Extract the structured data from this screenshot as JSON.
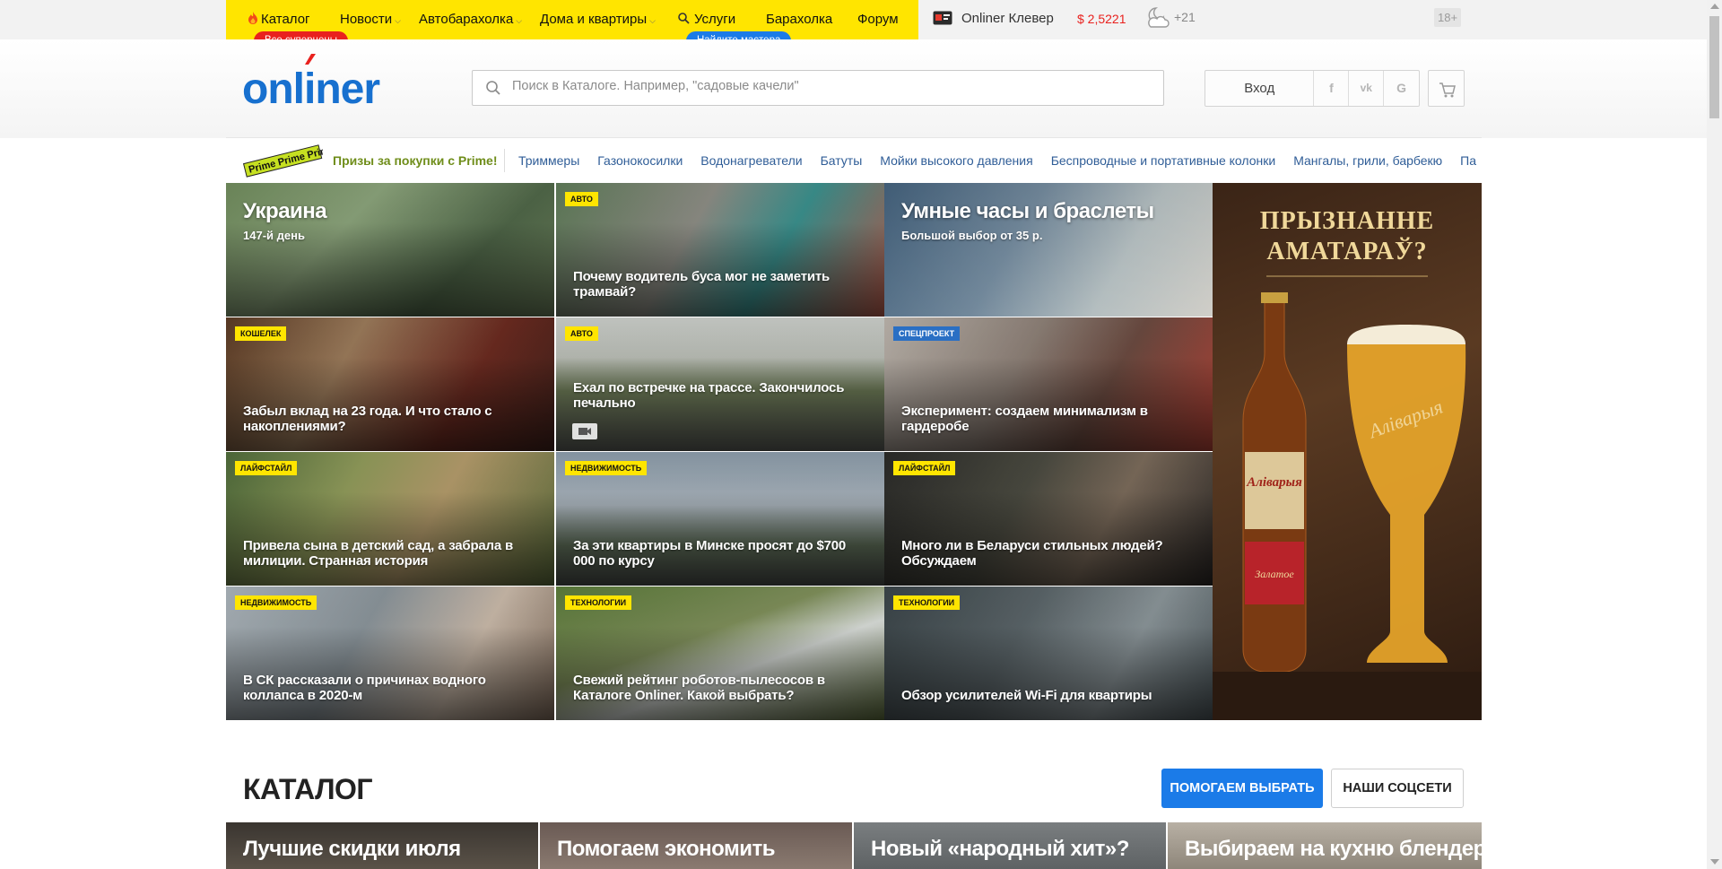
{
  "topnav": {
    "items": [
      {
        "label": "Каталог"
      },
      {
        "label": "Новости"
      },
      {
        "label": "Автобарахолка"
      },
      {
        "label": "Дома и квартиры"
      },
      {
        "label": "Услуги"
      },
      {
        "label": "Барахолка"
      },
      {
        "label": "Форум"
      }
    ],
    "pill_catalog": "Все суперцены",
    "pill_services": "Найдите мастера",
    "clever": "Onliner Клевер",
    "currency": "$ 2,5221",
    "weather": "+21",
    "age": "18+"
  },
  "header": {
    "logo": "onliner",
    "search_placeholder": "Поиск в Каталоге. Например, \"садовые качели\"",
    "login": "Вход",
    "social": [
      "f",
      "vk",
      "G"
    ]
  },
  "strip": {
    "prime_logo": "Prime",
    "prime_text": "Призы за покупки с Prime!",
    "links": [
      "Триммеры",
      "Газонокосилки",
      "Водонагреватели",
      "Батуты",
      "Мойки высокого давления",
      "Беспроводные и портативные колонки",
      "Мангалы, грили, барбекю",
      "Па"
    ]
  },
  "news": [
    {
      "title": "Украина",
      "subtitle": "147-й день",
      "badge": ""
    },
    {
      "title": "Почему водитель буса мог не заметить трамвай?",
      "badge": "Авто"
    },
    {
      "title": "Умные часы и браслеты",
      "subtitle": "Большой выбор от 35 р.",
      "badge": ""
    },
    {
      "title": "Забыл вклад на 23 года. И что стало с накоплениями?",
      "badge": "Кошелек"
    },
    {
      "title": "Ехал по встречке на трассе. Закончилось печально",
      "badge": "Авто"
    },
    {
      "title": "Эксперимент: создаем минимализм в гардеробе",
      "badge": "Спецпроект"
    },
    {
      "title": "Привела сына в детский сад, а забрала в милиции. Странная история",
      "badge": "Лайфстайл"
    },
    {
      "title": "За эти квартиры в Минске просят до $700 000 по курсу",
      "badge": "Недвижимость"
    },
    {
      "title": "Много ли в Беларуси стильных людей? Обсуждаем",
      "badge": "Лайфстайл"
    },
    {
      "title": "В СК рассказали о причинах водного коллапса в 2020-м",
      "badge": "Недвижимость"
    },
    {
      "title": "Свежий рейтинг роботов-пылесосов в Каталоге Onliner. Какой выбрать?",
      "badge": "Технологии"
    },
    {
      "title": "Обзор усилителей Wi-Fi для квартиры",
      "badge": "Технологии"
    }
  ],
  "ad": {
    "title_line1": "ПРЫЗНАННЕ",
    "title_line2": "АМАТАРАЎ?",
    "brand": "Аліварыя",
    "label": "Залатое"
  },
  "catalog": {
    "title": "КАТАЛОГ",
    "help_button": "ПОМОГАЕМ ВЫБРАТЬ",
    "social_button": "НАШИ СОЦСЕТИ",
    "cards": [
      "Лучшие скидки июля",
      "Помогаем экономить",
      "Новый «народный хит»?",
      "Выбираем на кухню блендер"
    ]
  },
  "colors": {
    "topbar_yellow": "#ffe500",
    "brand_blue": "#1770cf",
    "currency_red": "#e9211e",
    "primary_button": "#1b7be8"
  }
}
